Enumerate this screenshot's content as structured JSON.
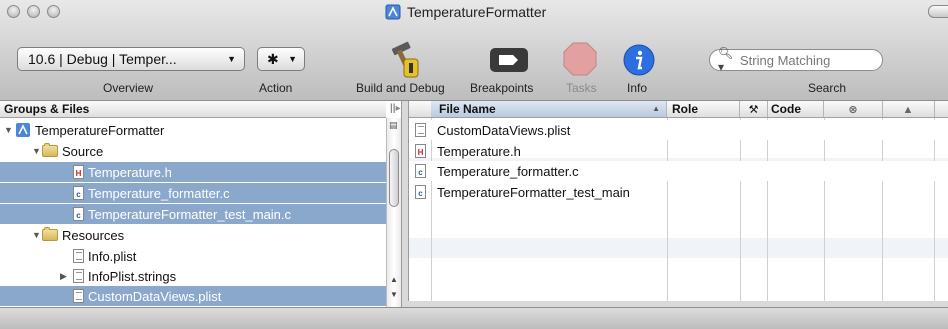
{
  "window": {
    "title": "TemperatureFormatter"
  },
  "toolbar": {
    "overview_value": "10.6 | Debug | Temper...",
    "overview_label": "Overview",
    "action_label": "Action",
    "build_debug_label": "Build and Debug",
    "breakpoints_label": "Breakpoints",
    "tasks_label": "Tasks",
    "info_label": "Info",
    "search_placeholder": "String Matching",
    "search_label": "Search"
  },
  "groups": {
    "header": "Groups & Files",
    "items": [
      {
        "label": "TemperatureFormatter",
        "kind": "project",
        "disclosure": "open",
        "indent": 0,
        "selected": false
      },
      {
        "label": "Source",
        "kind": "folder",
        "disclosure": "open",
        "indent": 1,
        "selected": false
      },
      {
        "label": "Temperature.h",
        "kind": "h",
        "disclosure": "",
        "indent": 2,
        "selected": true
      },
      {
        "label": "Temperature_formatter.c",
        "kind": "c",
        "disclosure": "",
        "indent": 2,
        "selected": true
      },
      {
        "label": "TemperatureFormatter_test_main.c",
        "kind": "c",
        "disclosure": "",
        "indent": 2,
        "selected": true
      },
      {
        "label": "Resources",
        "kind": "folder",
        "disclosure": "open",
        "indent": 1,
        "selected": false
      },
      {
        "label": "Info.plist",
        "kind": "plist",
        "disclosure": "",
        "indent": 2,
        "selected": false
      },
      {
        "label": "InfoPlist.strings",
        "kind": "plist",
        "disclosure": "closed",
        "indent": 2,
        "selected": false
      },
      {
        "label": "CustomDataViews.plist",
        "kind": "plist",
        "disclosure": "",
        "indent": 2,
        "selected": true
      }
    ]
  },
  "files": {
    "columns": {
      "name": "File Name",
      "role": "Role",
      "code": "Code"
    },
    "rows": [
      {
        "name": "CustomDataViews.plist",
        "kind": "plist"
      },
      {
        "name": "Temperature.h",
        "kind": "h"
      },
      {
        "name": "Temperature_formatter.c",
        "kind": "c"
      },
      {
        "name": "TemperatureFormatter_test_main",
        "kind": "c"
      }
    ]
  },
  "colors": {
    "selection": "#8aa8cc",
    "info_blue": "#2b6fe0",
    "tasks_red": "#e3a0a0"
  }
}
